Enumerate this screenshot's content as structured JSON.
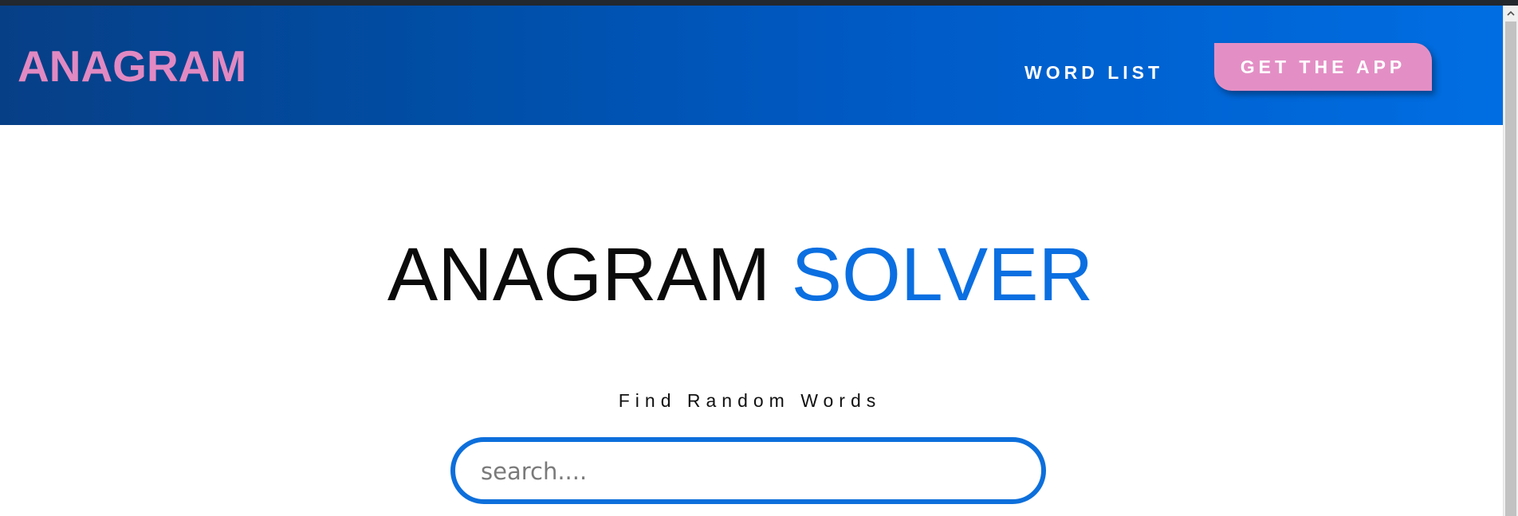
{
  "header": {
    "brand": "ANAGRAM",
    "nav_link": "WORD LIST",
    "cta_label": "GET THE APP"
  },
  "main": {
    "title_part1": "ANAGRAM",
    "title_part2": "SOLVER",
    "subtitle": "Find Random Words",
    "search": {
      "placeholder": "search....",
      "value": ""
    }
  },
  "colors": {
    "brand_pink": "#e189c2",
    "accent_blue": "#0b6fe1",
    "header_dark": "#073f86",
    "header_light": "#006ee2"
  },
  "icons": {
    "scroll_up": "chevron-up-icon"
  }
}
